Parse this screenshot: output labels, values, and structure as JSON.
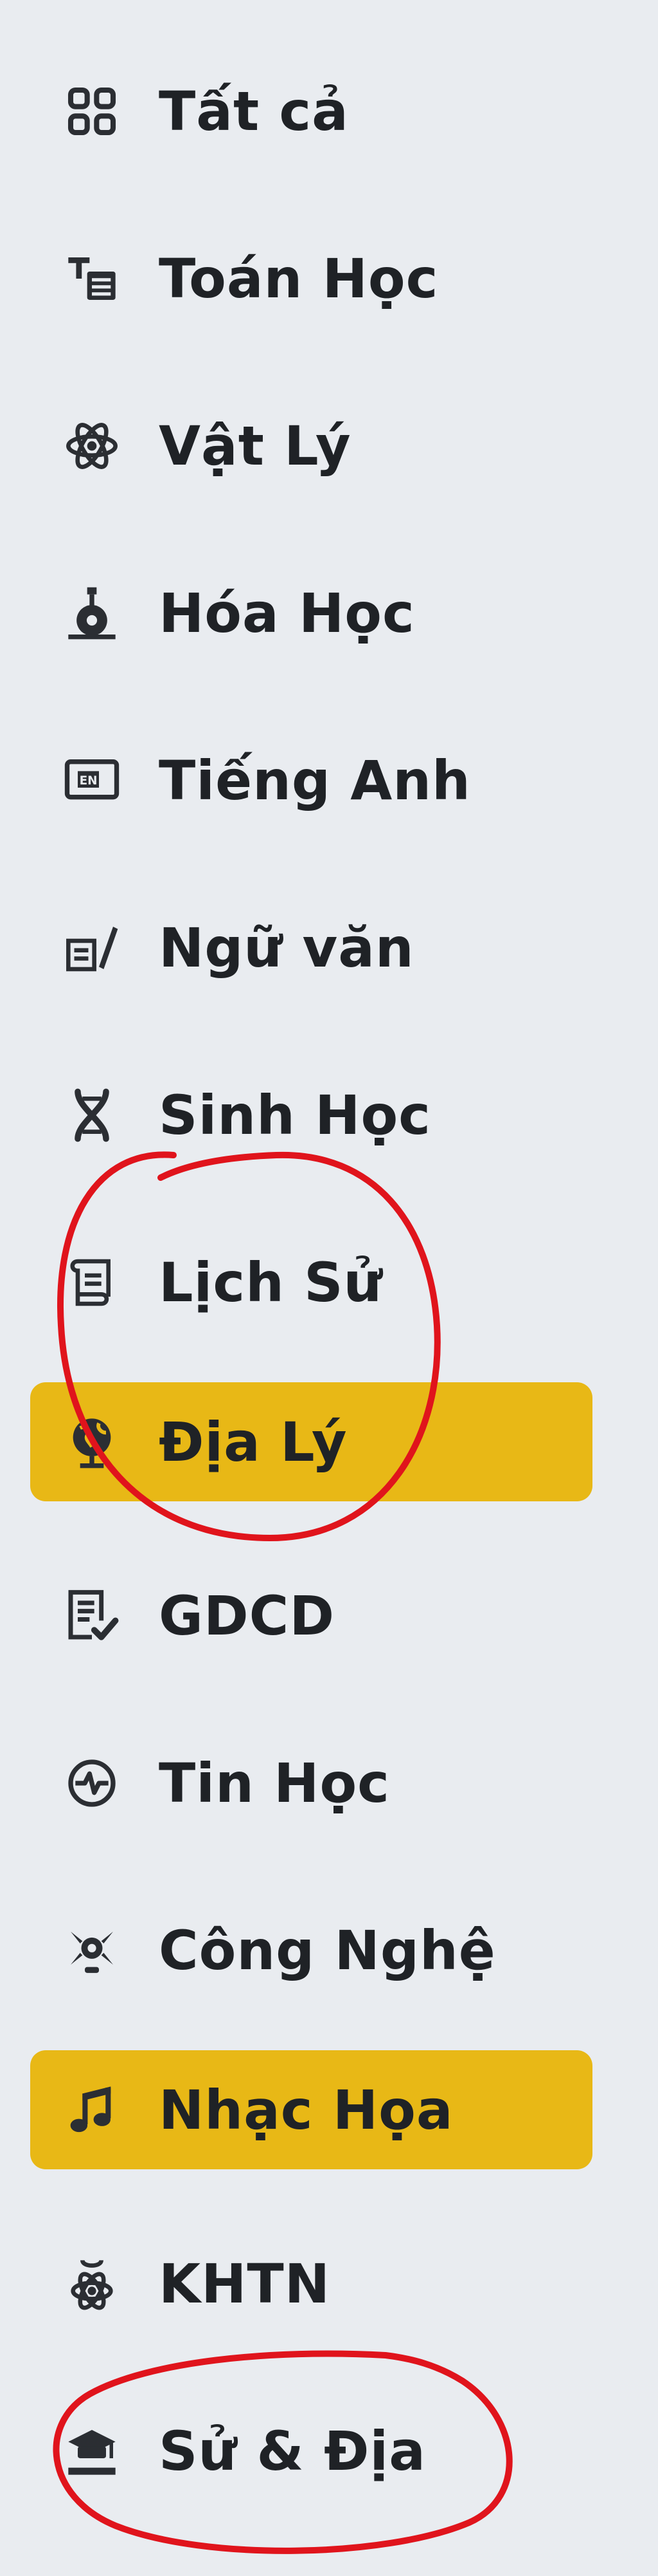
{
  "sidebar": {
    "items": [
      {
        "label": "Tất cả",
        "icon": "grid-icon",
        "active": false
      },
      {
        "label": "Toán Học",
        "icon": "math-icon",
        "active": false
      },
      {
        "label": "Vật Lý",
        "icon": "atom-icon",
        "active": false
      },
      {
        "label": "Hóa Học",
        "icon": "flask-icon",
        "active": false
      },
      {
        "label": "Tiếng Anh",
        "icon": "english-icon",
        "active": false
      },
      {
        "label": "Ngữ văn",
        "icon": "literature-icon",
        "active": false
      },
      {
        "label": "Sinh Học",
        "icon": "dna-icon",
        "active": false
      },
      {
        "label": "Lịch Sử",
        "icon": "scroll-icon",
        "active": false
      },
      {
        "label": "Địa Lý",
        "icon": "globe-icon",
        "active": true
      },
      {
        "label": "GDCD",
        "icon": "civics-icon",
        "active": false
      },
      {
        "label": "Tin Học",
        "icon": "computer-icon",
        "active": false
      },
      {
        "label": "Công Nghệ",
        "icon": "technology-icon",
        "active": false
      },
      {
        "label": "Nhạc Họa",
        "icon": "music-icon",
        "active": true
      },
      {
        "label": "KHTN",
        "icon": "science-icon",
        "active": false
      },
      {
        "label": "Sử & Địa",
        "icon": "history-geography-icon",
        "active": false
      }
    ]
  },
  "colors": {
    "background": "#e9ecf0",
    "active_background": "#e8b816",
    "text": "#1f2226",
    "annotation": "#e0141c"
  }
}
